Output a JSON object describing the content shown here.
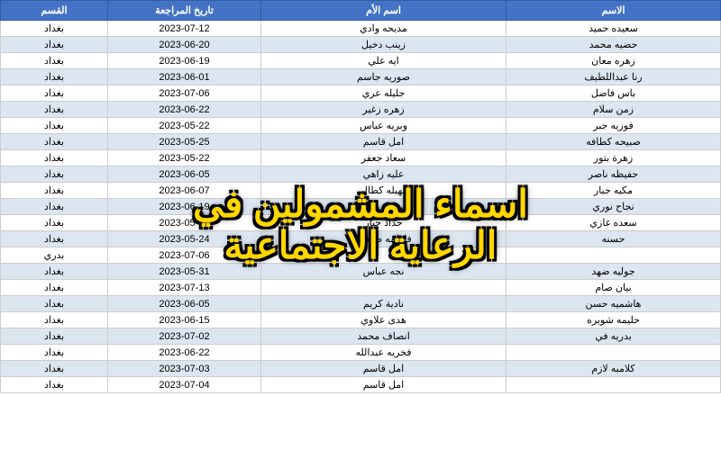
{
  "overlay": {
    "line1": "اسماء المشمولين في",
    "line2": "الرعاية الاجتماعية"
  },
  "table": {
    "headers": [
      "الاسم",
      "اسم الأم",
      "تاريخ المراجعة",
      "القسم"
    ],
    "rows": [
      [
        "سعيده حميد",
        "",
        "2023-07-12",
        "بغداد"
      ],
      [
        "حضيه محمد",
        "مديحه وادي",
        "2023-06-20",
        "بغداد"
      ],
      [
        "زهره معان",
        "زينب دخيل",
        "2023-06-19",
        "بغداد"
      ],
      [
        "رنا عبداللطيف",
        "ايه علي",
        "2023-06-01",
        "بغداد"
      ],
      [
        "باس فاضل",
        "صوريه جاسم",
        "2023-07-06",
        "بغداد"
      ],
      [
        "زمن سلام",
        "جليله عري",
        "2023-06-22",
        "بغداد"
      ],
      [
        "فوزيه جبر",
        "زهره زغير",
        "2023-05-22",
        "بغداد"
      ],
      [
        "صبيحه كطافه",
        "وبريه عباس",
        "2023-05-25",
        "بغداد"
      ],
      [
        "زهرة بتور",
        "امل قاسم",
        "2023-05-22",
        "بغداد"
      ],
      [
        "حفيظه ناصر",
        "سعاد جعفر",
        "2023-06-05",
        "بغداد"
      ],
      [
        "مكيه جبار",
        "عليه زاهي",
        "2023-06-07",
        "بغداد"
      ],
      [
        "نجاح نوري",
        "سهيله كطالي",
        "2023-06-19",
        "بغداد"
      ],
      [
        "سعده غازي",
        "رسيمه محمد",
        "2023-05-23",
        "بغداد"
      ],
      [
        "حسنه",
        "حداد جبار",
        "2023-05-24",
        "بغداد"
      ],
      [
        "",
        "فاطمه طلعمه",
        "2023-07-06",
        "بدري"
      ],
      [
        "جوليه ضهد",
        "",
        "2023-05-31",
        "بغداد"
      ],
      [
        "بيان صام",
        "",
        "2023-07-13",
        "بغداد"
      ],
      [
        "هاشميه حسن",
        "نادية كريم",
        "2023-06-05",
        "بغداد"
      ],
      [
        "حليمه شويره",
        "هدى علاوي",
        "2023-06-15",
        "بغداد"
      ],
      [
        "بدريه في",
        "انصاف محمد",
        "2023-07-02",
        "بغداد"
      ],
      [
        "",
        "فخريه عبدالله",
        "2023-06-22",
        "بغداد"
      ],
      [
        "كلامبه لازم",
        "امل قاسم",
        "2023-07-03",
        "بغداد"
      ],
      [
        "",
        "",
        "2023-07-04",
        "بغداد"
      ]
    ]
  }
}
